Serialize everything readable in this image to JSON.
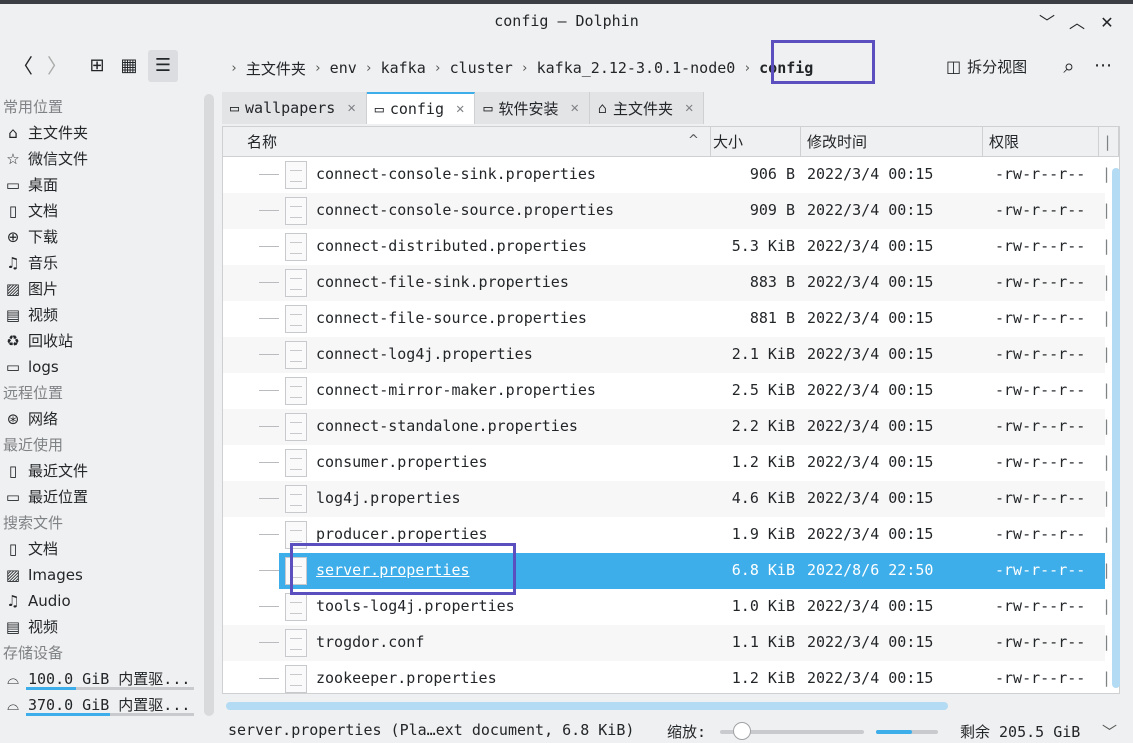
{
  "window": {
    "title": "config — Dolphin",
    "minimize": "﹀",
    "maximize": "︿",
    "close": "✕"
  },
  "toolbar": {
    "back": "〈",
    "forward": "〉",
    "view_icons": "⊞",
    "view_compact": "▦",
    "view_details": "☰",
    "split_label": "拆分视图",
    "search": "⌕",
    "menu": "⋯"
  },
  "breadcrumb": {
    "items": [
      "主文件夹",
      "env",
      "kafka",
      "cluster",
      "kafka_2.12-3.0.1-node0"
    ],
    "current": "config",
    "separator": "›"
  },
  "sidebar": {
    "sections": [
      {
        "title": "常用位置",
        "items": [
          {
            "icon": "home-icon",
            "glyph": "⌂",
            "label": "主文件夹"
          },
          {
            "icon": "star-icon",
            "glyph": "☆",
            "label": "微信文件"
          },
          {
            "icon": "desktop-icon",
            "glyph": "▭",
            "label": "桌面"
          },
          {
            "icon": "document-icon",
            "glyph": "▯",
            "label": "文档"
          },
          {
            "icon": "download-icon",
            "glyph": "⊕",
            "label": "下载"
          },
          {
            "icon": "music-icon",
            "glyph": "♫",
            "label": "音乐"
          },
          {
            "icon": "picture-icon",
            "glyph": "▨",
            "label": "图片"
          },
          {
            "icon": "video-icon",
            "glyph": "▤",
            "label": "视频"
          },
          {
            "icon": "trash-icon",
            "glyph": "♻",
            "label": "回收站"
          },
          {
            "icon": "folder-icon",
            "glyph": "▭",
            "label": "logs"
          }
        ]
      },
      {
        "title": "远程位置",
        "items": [
          {
            "icon": "network-icon",
            "glyph": "⊛",
            "label": "网络"
          }
        ]
      },
      {
        "title": "最近使用",
        "items": [
          {
            "icon": "recent-files-icon",
            "glyph": "▯",
            "label": "最近文件"
          },
          {
            "icon": "recent-locations-icon",
            "glyph": "▭",
            "label": "最近位置"
          }
        ]
      },
      {
        "title": "搜索文件",
        "items": [
          {
            "icon": "document-icon",
            "glyph": "▯",
            "label": "文档"
          },
          {
            "icon": "image-icon",
            "glyph": "▨",
            "label": "Images"
          },
          {
            "icon": "audio-icon",
            "glyph": "♫",
            "label": "Audio"
          },
          {
            "icon": "video-icon",
            "glyph": "▤",
            "label": "视频"
          }
        ]
      }
    ],
    "devices": {
      "title": "存储设备",
      "items": [
        {
          "icon": "drive-icon",
          "glyph": "⌓",
          "label": "100.0 GiB 内置驱...",
          "usage": 0.3
        },
        {
          "icon": "drive-icon",
          "glyph": "⌓",
          "label": "370.0 GiB 内置驱...",
          "usage": 0.5
        }
      ]
    }
  },
  "tabs": [
    {
      "icon": "folder-icon",
      "glyph": "▭",
      "label": "wallpapers",
      "active": false
    },
    {
      "icon": "folder-icon",
      "glyph": "▭",
      "label": "config",
      "active": true
    },
    {
      "icon": "folder-icon",
      "glyph": "▭",
      "label": "软件安装",
      "active": false
    },
    {
      "icon": "home-icon",
      "glyph": "⌂",
      "label": "主文件夹",
      "active": false
    }
  ],
  "tab_close": "✕",
  "columns": {
    "name": "名称",
    "sort_indicator": "^",
    "size": "大小",
    "modified": "修改时间",
    "permissions": "权限",
    "edge": "|"
  },
  "files": [
    {
      "name": "connect-console-sink.properties",
      "size": "906 B",
      "modified": "2022/3/4 00:15",
      "perm": "-rw-r--r--"
    },
    {
      "name": "connect-console-source.properties",
      "size": "909 B",
      "modified": "2022/3/4 00:15",
      "perm": "-rw-r--r--"
    },
    {
      "name": "connect-distributed.properties",
      "size": "5.3 KiB",
      "modified": "2022/3/4 00:15",
      "perm": "-rw-r--r--"
    },
    {
      "name": "connect-file-sink.properties",
      "size": "883 B",
      "modified": "2022/3/4 00:15",
      "perm": "-rw-r--r--"
    },
    {
      "name": "connect-file-source.properties",
      "size": "881 B",
      "modified": "2022/3/4 00:15",
      "perm": "-rw-r--r--"
    },
    {
      "name": "connect-log4j.properties",
      "size": "2.1 KiB",
      "modified": "2022/3/4 00:15",
      "perm": "-rw-r--r--"
    },
    {
      "name": "connect-mirror-maker.properties",
      "size": "2.5 KiB",
      "modified": "2022/3/4 00:15",
      "perm": "-rw-r--r--"
    },
    {
      "name": "connect-standalone.properties",
      "size": "2.2 KiB",
      "modified": "2022/3/4 00:15",
      "perm": "-rw-r--r--"
    },
    {
      "name": "consumer.properties",
      "size": "1.2 KiB",
      "modified": "2022/3/4 00:15",
      "perm": "-rw-r--r--"
    },
    {
      "name": "log4j.properties",
      "size": "4.6 KiB",
      "modified": "2022/3/4 00:15",
      "perm": "-rw-r--r--"
    },
    {
      "name": "producer.properties",
      "size": "1.9 KiB",
      "modified": "2022/3/4 00:15",
      "perm": "-rw-r--r--"
    },
    {
      "name": "server.properties",
      "size": "6.8 KiB",
      "modified": "2022/8/6 22:50",
      "perm": "-rw-r--r--",
      "selected": true
    },
    {
      "name": "tools-log4j.properties",
      "size": "1.0 KiB",
      "modified": "2022/3/4 00:15",
      "perm": "-rw-r--r--"
    },
    {
      "name": "trogdor.conf",
      "size": "1.1 KiB",
      "modified": "2022/3/4 00:15",
      "perm": "-rw-r--r--"
    },
    {
      "name": "zookeeper.properties",
      "size": "1.2 KiB",
      "modified": "2022/3/4 00:15",
      "perm": "-rw-r--r--"
    }
  ],
  "statusbar": {
    "text": "server.properties (Pla…ext document, 6.8 KiB)",
    "zoom_label": "缩放:",
    "zoom_level": 0.15,
    "space_usage": 0.58,
    "free_text": "剩余 205.5 GiB",
    "dropdown": "﹀"
  },
  "colors": {
    "accent": "#3daee9",
    "highlight_box": "#5b4fbf",
    "selection_text": "#ffffff"
  }
}
